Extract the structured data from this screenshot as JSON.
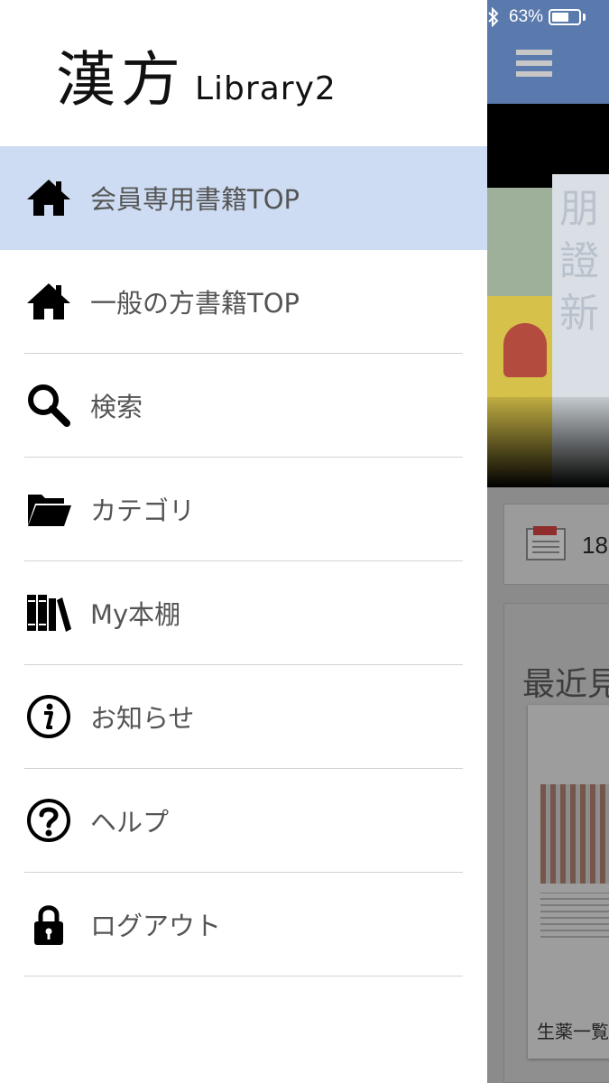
{
  "status_bar": {
    "battery_text": "63%",
    "battery_level": 0.63,
    "bluetooth_icon": "bluetooth-icon"
  },
  "app": {
    "header_color": "#5a79ad",
    "menu_icon": "hamburger-icon",
    "news": {
      "icon": "newspaper-icon",
      "count": "18"
    },
    "recent": {
      "title": "最近見",
      "book_title": "生薬一覧"
    }
  },
  "drawer": {
    "logo": {
      "kanji": "漢方",
      "latin": "Library2"
    },
    "active_color": "#cddcf2",
    "items": [
      {
        "label": "会員専用書籍TOP",
        "icon": "home-icon",
        "active": true
      },
      {
        "label": "一般の方書籍TOP",
        "icon": "home-icon",
        "active": false
      },
      {
        "label": "検索",
        "icon": "search-icon",
        "active": false
      },
      {
        "label": "カテゴリ",
        "icon": "folder-icon",
        "active": false
      },
      {
        "label": "My本棚",
        "icon": "bookshelf-icon",
        "active": false
      },
      {
        "label": "お知らせ",
        "icon": "info-icon",
        "active": false
      },
      {
        "label": "ヘルプ",
        "icon": "help-icon",
        "active": false
      },
      {
        "label": "ログアウト",
        "icon": "lock-icon",
        "active": false
      }
    ]
  }
}
